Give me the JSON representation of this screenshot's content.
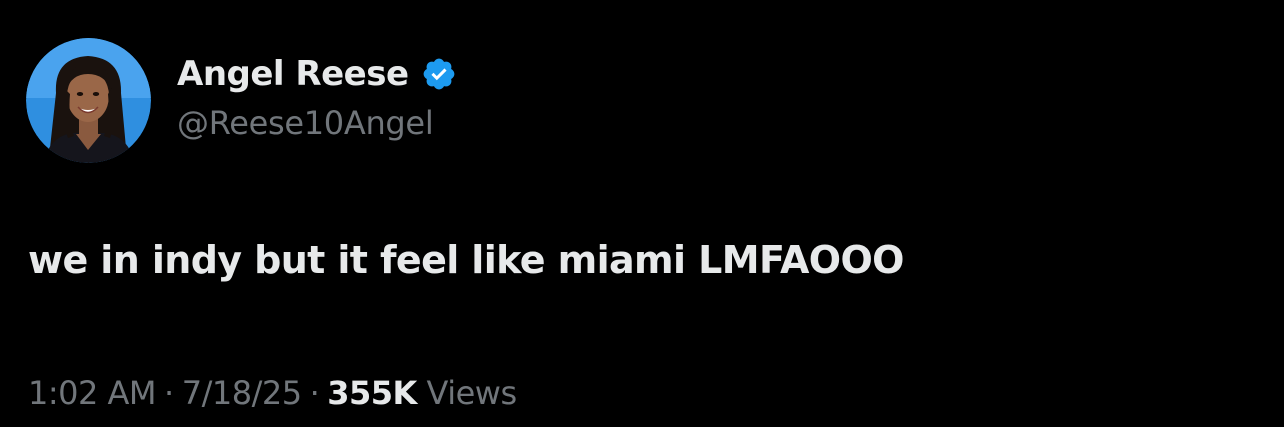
{
  "author": {
    "display_name": "Angel Reese",
    "handle": "@Reese10Angel",
    "verified_icon": "verified-badge-icon",
    "badge_color": "#1d9bf0"
  },
  "tweet": {
    "text": "we in indy but it feel like miami LMFAOOO"
  },
  "meta": {
    "time": "1:02 AM",
    "separator": "·",
    "date": "7/18/25",
    "views_count": "355K",
    "views_label": "Views"
  },
  "colors": {
    "background": "#000000",
    "primary_text": "#e7e9ea",
    "secondary_text": "#71767b"
  }
}
